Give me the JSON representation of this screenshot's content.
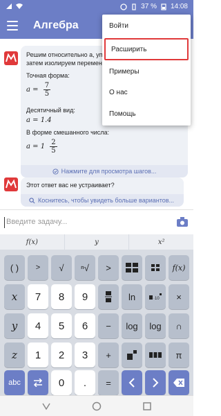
{
  "status": {
    "battery": "37 %",
    "time": "14:08"
  },
  "appbar": {
    "title": "Алгебра"
  },
  "menu": {
    "items": [
      {
        "label": "Войти"
      },
      {
        "label": "Расширить"
      },
      {
        "label": "Примеры"
      },
      {
        "label": "О нас"
      },
      {
        "label": "Помощь"
      }
    ]
  },
  "answer": {
    "intro1": "Решим относительно a, упро",
    "intro2": "затем изолируем переменную.",
    "exact_label": "Точная форма:",
    "exact_var": "a =",
    "exact_num": "7",
    "exact_den": "5",
    "decimal_label": "Десятичный вид:",
    "decimal_value": "a = 1.4",
    "mixed_label": "В форме смешанного числа:",
    "mixed_var": "a = 1",
    "mixed_num": "2",
    "mixed_den": "5",
    "steps_link": "Нажмите для просмотра шагов..."
  },
  "feedback": {
    "question": "Этот ответ вас не устраивает?",
    "link": "Коснитесь, чтобы увидеть больше вариантов..."
  },
  "input": {
    "placeholder": "Введите задачу..."
  },
  "keyboard": {
    "functions": [
      "f(x)",
      "y",
      "x²"
    ],
    "keys": {
      "paren": "( )",
      "gt": ">",
      "sqrt": "√",
      "nthroot": "ⁿ√",
      "x": "x",
      "seven": "7",
      "eight": "8",
      "nine": "9",
      "times": "×",
      "ln": "ln",
      "y": "y",
      "four": "4",
      "five": "5",
      "six": "6",
      "minus": "−",
      "log": "log",
      "logb": "log",
      "cap": "∩",
      "z": "z",
      "one": "1",
      "two": "2",
      "three": "3",
      "plus": "+",
      "pi": "π",
      "abc": "abc",
      "zero": "0",
      "dot": ".",
      "equals": "=",
      "lt_arrow": "<",
      "gt_arrow": ">"
    }
  },
  "colors": {
    "primary": "#6c7ec6",
    "highlight": "#e0393a",
    "keyboard_bg": "#d8dce3"
  }
}
